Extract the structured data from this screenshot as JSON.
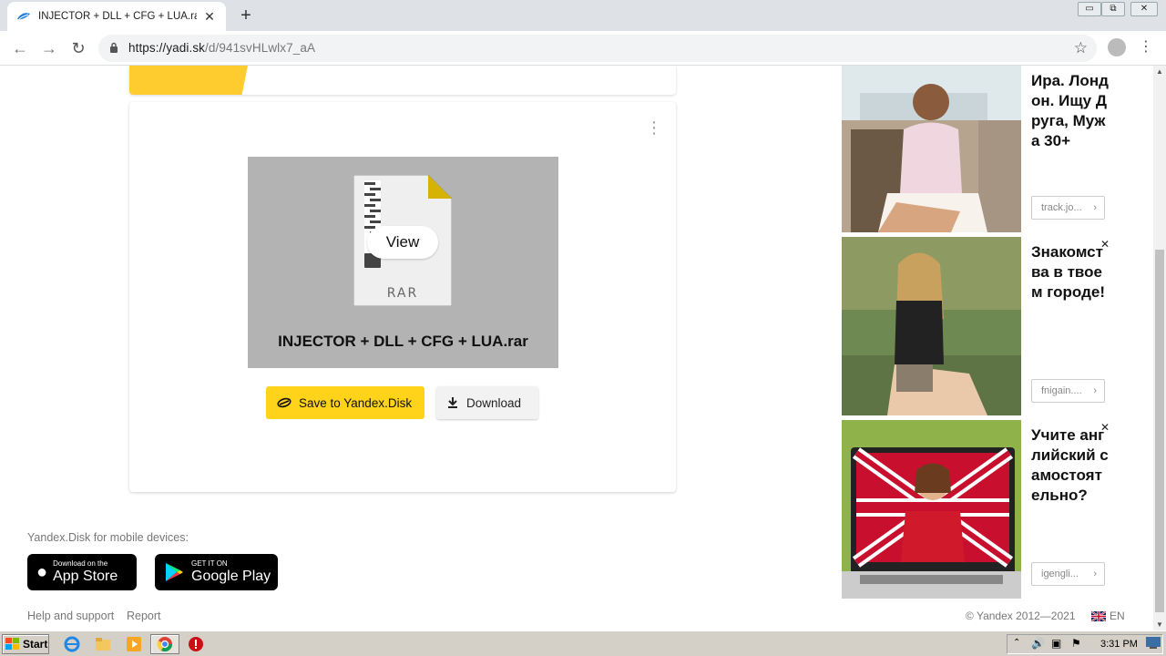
{
  "browser": {
    "tab_title": "INJECTOR + DLL + CFG + LUA.rar -",
    "url_host": "https://yadi.sk",
    "url_path": "/d/941svHLwlx7_aA",
    "window_buttons": [
      "▭",
      "⧉",
      "✕"
    ]
  },
  "file": {
    "name": "INJECTOR + DLL + CFG + LUA.rar",
    "type_label": "RAR",
    "view_label": "View"
  },
  "actions": {
    "save_label": "Save to Yandex.Disk",
    "download_label": "Download"
  },
  "footer": {
    "mobile_text": "Yandex.Disk for mobile devices:",
    "appstore_small": "Download on the",
    "appstore_big": "App Store",
    "googleplay_small": "GET IT ON",
    "googleplay_big": "Google Play",
    "help_link": "Help and support",
    "report_link": "Report",
    "copyright": "© Yandex 2012—2021",
    "lang": "EN"
  },
  "ads": [
    {
      "title": "Ира. Лондон. Ищу Друга, Мужа 30+",
      "link": "track.jo...",
      "close": ""
    },
    {
      "title": "Знакомства в твоем городе!",
      "link": "fnigain....",
      "close": "✕"
    },
    {
      "title": "Учите английский самостоятельно?",
      "link": "igengli...",
      "close": "✕"
    }
  ],
  "taskbar": {
    "start_label": "Start",
    "clock": "3:31 PM"
  },
  "colors": {
    "yandex_yellow": "#ffd31a",
    "preview_gray": "#b3b3b3",
    "rar_accent": "#d6b300"
  },
  "icons": {
    "tab": "yandex-disk-icon",
    "lock": "lock-icon",
    "star": "star-icon",
    "kebab": "more-icon",
    "download": "download-icon"
  }
}
